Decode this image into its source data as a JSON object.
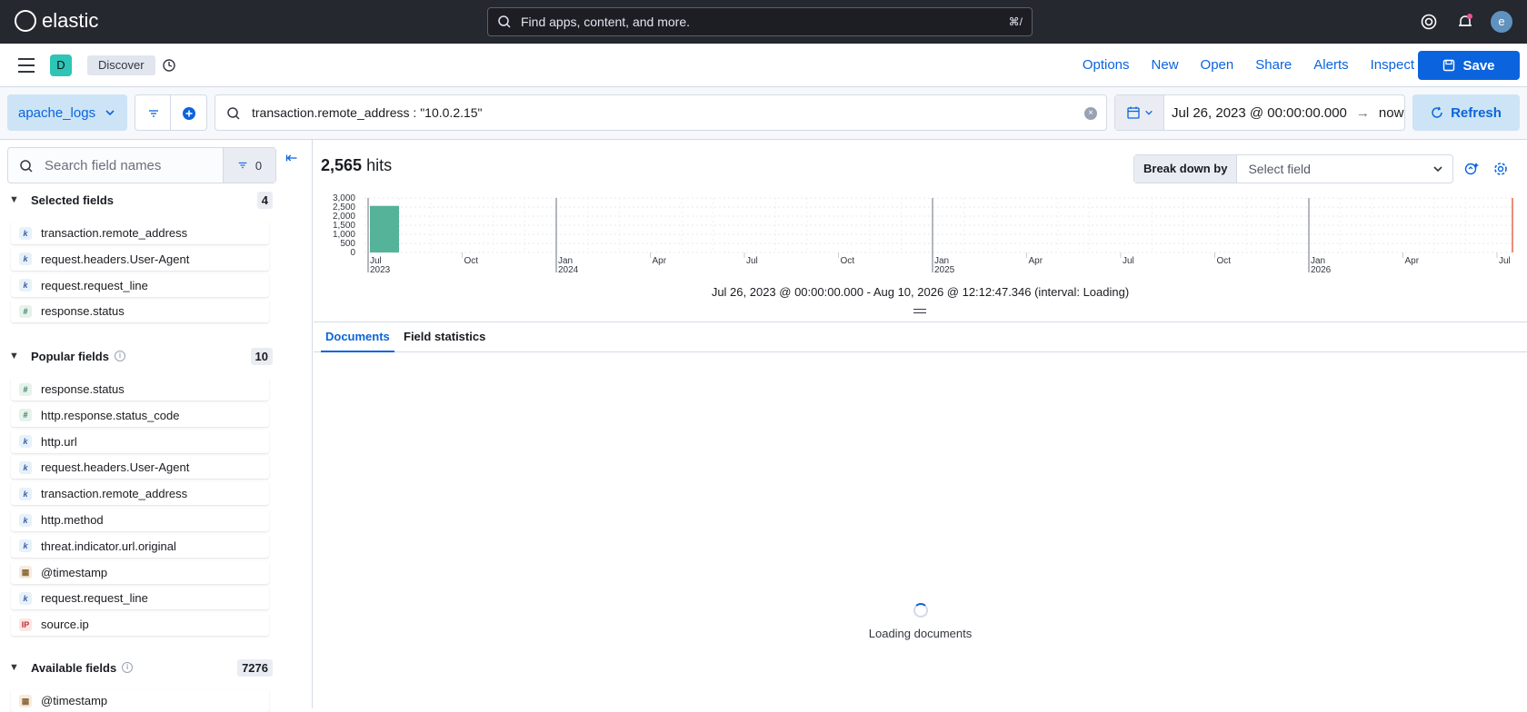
{
  "header": {
    "brand": "elastic",
    "search_placeholder": "Find apps, content, and more.",
    "search_shortcut": "⌘/",
    "user_initial": "e"
  },
  "nav": {
    "space_initial": "D",
    "breadcrumb": "Discover",
    "links": [
      "Options",
      "New",
      "Open",
      "Share",
      "Alerts",
      "Inspect"
    ],
    "save_label": "Save"
  },
  "query": {
    "data_view": "apache_logs",
    "query_text": "transaction.remote_address : \"10.0.2.15\"",
    "date_start": "Jul 26, 2023 @ 00:00:00.000",
    "date_end": "now",
    "refresh_label": "Refresh"
  },
  "sidebar": {
    "search_placeholder": "Search field names",
    "filter_count": "0",
    "selected": {
      "title": "Selected fields",
      "count": "4",
      "fields": [
        {
          "name": "transaction.remote_address",
          "type": "k"
        },
        {
          "name": "request.headers.User-Agent",
          "type": "k"
        },
        {
          "name": "request.request_line",
          "type": "k"
        },
        {
          "name": "response.status",
          "type": "#"
        }
      ]
    },
    "popular": {
      "title": "Popular fields",
      "count": "10",
      "fields": [
        {
          "name": "response.status",
          "type": "#"
        },
        {
          "name": "http.response.status_code",
          "type": "#"
        },
        {
          "name": "http.url",
          "type": "k"
        },
        {
          "name": "request.headers.User-Agent",
          "type": "k"
        },
        {
          "name": "transaction.remote_address",
          "type": "k"
        },
        {
          "name": "http.method",
          "type": "k"
        },
        {
          "name": "threat.indicator.url.original",
          "type": "k"
        },
        {
          "name": "@timestamp",
          "type": "date"
        },
        {
          "name": "request.request_line",
          "type": "k"
        },
        {
          "name": "source.ip",
          "type": "ip"
        }
      ]
    },
    "available": {
      "title": "Available fields",
      "count": "7276",
      "fields": [
        {
          "name": "@timestamp",
          "type": "date"
        }
      ]
    }
  },
  "main": {
    "hits_count": "2,565",
    "hits_label": "hits",
    "breakdown_label": "Break down by",
    "breakdown_placeholder": "Select field",
    "time_range": "Jul 26, 2023 @ 00:00:00.000 - Aug 10, 2026 @ 12:12:47.346 (interval: Loading)",
    "tabs": [
      "Documents",
      "Field statistics"
    ],
    "loading_text": "Loading documents"
  },
  "chart_data": {
    "type": "bar",
    "y_ticks": [
      "3,000",
      "2,500",
      "2,000",
      "1,500",
      "1,000",
      "500",
      "0"
    ],
    "ylim": [
      0,
      3000
    ],
    "x_ticks": [
      {
        "label": "Jul",
        "year": "2023"
      },
      {
        "label": "Oct",
        "year": ""
      },
      {
        "label": "Jan",
        "year": "2024"
      },
      {
        "label": "Apr",
        "year": ""
      },
      {
        "label": "Jul",
        "year": ""
      },
      {
        "label": "Oct",
        "year": ""
      },
      {
        "label": "Jan",
        "year": "2025"
      },
      {
        "label": "Apr",
        "year": ""
      },
      {
        "label": "Jul",
        "year": ""
      },
      {
        "label": "Oct",
        "year": ""
      },
      {
        "label": "Jan",
        "year": "2026"
      },
      {
        "label": "Apr",
        "year": ""
      },
      {
        "label": "Jul",
        "year": ""
      }
    ],
    "bars": [
      {
        "bucket_start": "Jul 2023",
        "value": 2565
      }
    ],
    "bar_color": "#54b399"
  }
}
